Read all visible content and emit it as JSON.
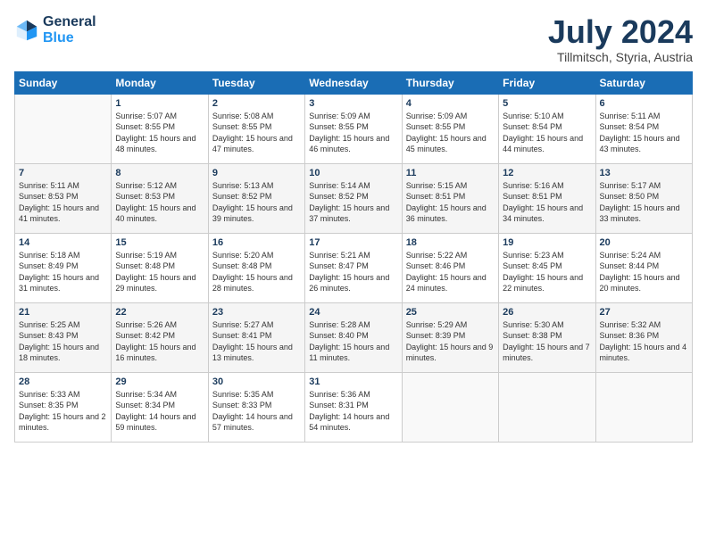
{
  "header": {
    "logo_general": "General",
    "logo_blue": "Blue",
    "month_title": "July 2024",
    "subtitle": "Tillmitsch, Styria, Austria"
  },
  "calendar": {
    "weekdays": [
      "Sunday",
      "Monday",
      "Tuesday",
      "Wednesday",
      "Thursday",
      "Friday",
      "Saturday"
    ],
    "weeks": [
      [
        {
          "day": "",
          "sunrise": "",
          "sunset": "",
          "daylight": ""
        },
        {
          "day": "1",
          "sunrise": "Sunrise: 5:07 AM",
          "sunset": "Sunset: 8:55 PM",
          "daylight": "Daylight: 15 hours and 48 minutes."
        },
        {
          "day": "2",
          "sunrise": "Sunrise: 5:08 AM",
          "sunset": "Sunset: 8:55 PM",
          "daylight": "Daylight: 15 hours and 47 minutes."
        },
        {
          "day": "3",
          "sunrise": "Sunrise: 5:09 AM",
          "sunset": "Sunset: 8:55 PM",
          "daylight": "Daylight: 15 hours and 46 minutes."
        },
        {
          "day": "4",
          "sunrise": "Sunrise: 5:09 AM",
          "sunset": "Sunset: 8:55 PM",
          "daylight": "Daylight: 15 hours and 45 minutes."
        },
        {
          "day": "5",
          "sunrise": "Sunrise: 5:10 AM",
          "sunset": "Sunset: 8:54 PM",
          "daylight": "Daylight: 15 hours and 44 minutes."
        },
        {
          "day": "6",
          "sunrise": "Sunrise: 5:11 AM",
          "sunset": "Sunset: 8:54 PM",
          "daylight": "Daylight: 15 hours and 43 minutes."
        }
      ],
      [
        {
          "day": "7",
          "sunrise": "Sunrise: 5:11 AM",
          "sunset": "Sunset: 8:53 PM",
          "daylight": "Daylight: 15 hours and 41 minutes."
        },
        {
          "day": "8",
          "sunrise": "Sunrise: 5:12 AM",
          "sunset": "Sunset: 8:53 PM",
          "daylight": "Daylight: 15 hours and 40 minutes."
        },
        {
          "day": "9",
          "sunrise": "Sunrise: 5:13 AM",
          "sunset": "Sunset: 8:52 PM",
          "daylight": "Daylight: 15 hours and 39 minutes."
        },
        {
          "day": "10",
          "sunrise": "Sunrise: 5:14 AM",
          "sunset": "Sunset: 8:52 PM",
          "daylight": "Daylight: 15 hours and 37 minutes."
        },
        {
          "day": "11",
          "sunrise": "Sunrise: 5:15 AM",
          "sunset": "Sunset: 8:51 PM",
          "daylight": "Daylight: 15 hours and 36 minutes."
        },
        {
          "day": "12",
          "sunrise": "Sunrise: 5:16 AM",
          "sunset": "Sunset: 8:51 PM",
          "daylight": "Daylight: 15 hours and 34 minutes."
        },
        {
          "day": "13",
          "sunrise": "Sunrise: 5:17 AM",
          "sunset": "Sunset: 8:50 PM",
          "daylight": "Daylight: 15 hours and 33 minutes."
        }
      ],
      [
        {
          "day": "14",
          "sunrise": "Sunrise: 5:18 AM",
          "sunset": "Sunset: 8:49 PM",
          "daylight": "Daylight: 15 hours and 31 minutes."
        },
        {
          "day": "15",
          "sunrise": "Sunrise: 5:19 AM",
          "sunset": "Sunset: 8:48 PM",
          "daylight": "Daylight: 15 hours and 29 minutes."
        },
        {
          "day": "16",
          "sunrise": "Sunrise: 5:20 AM",
          "sunset": "Sunset: 8:48 PM",
          "daylight": "Daylight: 15 hours and 28 minutes."
        },
        {
          "day": "17",
          "sunrise": "Sunrise: 5:21 AM",
          "sunset": "Sunset: 8:47 PM",
          "daylight": "Daylight: 15 hours and 26 minutes."
        },
        {
          "day": "18",
          "sunrise": "Sunrise: 5:22 AM",
          "sunset": "Sunset: 8:46 PM",
          "daylight": "Daylight: 15 hours and 24 minutes."
        },
        {
          "day": "19",
          "sunrise": "Sunrise: 5:23 AM",
          "sunset": "Sunset: 8:45 PM",
          "daylight": "Daylight: 15 hours and 22 minutes."
        },
        {
          "day": "20",
          "sunrise": "Sunrise: 5:24 AM",
          "sunset": "Sunset: 8:44 PM",
          "daylight": "Daylight: 15 hours and 20 minutes."
        }
      ],
      [
        {
          "day": "21",
          "sunrise": "Sunrise: 5:25 AM",
          "sunset": "Sunset: 8:43 PM",
          "daylight": "Daylight: 15 hours and 18 minutes."
        },
        {
          "day": "22",
          "sunrise": "Sunrise: 5:26 AM",
          "sunset": "Sunset: 8:42 PM",
          "daylight": "Daylight: 15 hours and 16 minutes."
        },
        {
          "day": "23",
          "sunrise": "Sunrise: 5:27 AM",
          "sunset": "Sunset: 8:41 PM",
          "daylight": "Daylight: 15 hours and 13 minutes."
        },
        {
          "day": "24",
          "sunrise": "Sunrise: 5:28 AM",
          "sunset": "Sunset: 8:40 PM",
          "daylight": "Daylight: 15 hours and 11 minutes."
        },
        {
          "day": "25",
          "sunrise": "Sunrise: 5:29 AM",
          "sunset": "Sunset: 8:39 PM",
          "daylight": "Daylight: 15 hours and 9 minutes."
        },
        {
          "day": "26",
          "sunrise": "Sunrise: 5:30 AM",
          "sunset": "Sunset: 8:38 PM",
          "daylight": "Daylight: 15 hours and 7 minutes."
        },
        {
          "day": "27",
          "sunrise": "Sunrise: 5:32 AM",
          "sunset": "Sunset: 8:36 PM",
          "daylight": "Daylight: 15 hours and 4 minutes."
        }
      ],
      [
        {
          "day": "28",
          "sunrise": "Sunrise: 5:33 AM",
          "sunset": "Sunset: 8:35 PM",
          "daylight": "Daylight: 15 hours and 2 minutes."
        },
        {
          "day": "29",
          "sunrise": "Sunrise: 5:34 AM",
          "sunset": "Sunset: 8:34 PM",
          "daylight": "Daylight: 14 hours and 59 minutes."
        },
        {
          "day": "30",
          "sunrise": "Sunrise: 5:35 AM",
          "sunset": "Sunset: 8:33 PM",
          "daylight": "Daylight: 14 hours and 57 minutes."
        },
        {
          "day": "31",
          "sunrise": "Sunrise: 5:36 AM",
          "sunset": "Sunset: 8:31 PM",
          "daylight": "Daylight: 14 hours and 54 minutes."
        },
        {
          "day": "",
          "sunrise": "",
          "sunset": "",
          "daylight": ""
        },
        {
          "day": "",
          "sunrise": "",
          "sunset": "",
          "daylight": ""
        },
        {
          "day": "",
          "sunrise": "",
          "sunset": "",
          "daylight": ""
        }
      ]
    ]
  }
}
